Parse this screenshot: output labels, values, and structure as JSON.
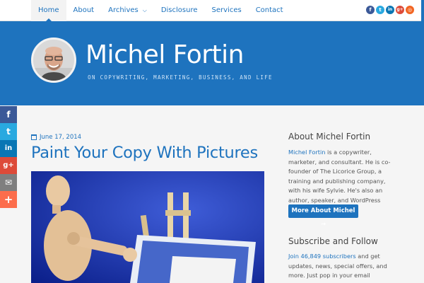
{
  "nav": {
    "items": [
      {
        "label": "Home",
        "active": true
      },
      {
        "label": "About"
      },
      {
        "label": "Archives",
        "has_dropdown": true
      },
      {
        "label": "Disclosure"
      },
      {
        "label": "Services"
      },
      {
        "label": "Contact"
      }
    ],
    "social": [
      {
        "icon": "facebook-icon",
        "glyph": "f",
        "color": "#3b5998"
      },
      {
        "icon": "twitter-icon",
        "glyph": "t",
        "color": "#29a9e0"
      },
      {
        "icon": "linkedin-icon",
        "glyph": "in",
        "color": "#0976b4"
      },
      {
        "icon": "googleplus-icon",
        "glyph": "g+",
        "color": "#dd4b39"
      },
      {
        "icon": "rss-icon",
        "glyph": "◎",
        "color": "#f26522"
      }
    ]
  },
  "header": {
    "site_title": "Michel Fortin",
    "tagline": "ON COPYWRITING, MARKETING, BUSINESS, AND LIFE"
  },
  "share_bar": [
    {
      "icon": "facebook-share-icon",
      "glyph": "f",
      "color": "#3b5998"
    },
    {
      "icon": "twitter-share-icon",
      "glyph": "t",
      "color": "#29a9e0"
    },
    {
      "icon": "linkedin-share-icon",
      "glyph": "in",
      "color": "#0976b4"
    },
    {
      "icon": "googleplus-share-icon",
      "glyph": "g+",
      "color": "#dd4b39"
    },
    {
      "icon": "email-share-icon",
      "glyph": "✉",
      "color": "#7f7f7f"
    },
    {
      "icon": "more-share-icon",
      "glyph": "+",
      "color": "#fc6d4c"
    }
  ],
  "post": {
    "date": "June 17, 2014",
    "title": "Paint Your Copy With Pictures"
  },
  "sidebar": {
    "about": {
      "title": "About Michel Fortin",
      "link": "Michel Fortin",
      "text": " is a copywriter, marketer, and consultant. He is co-founder of The Licorice Group, a training and publishing company, with his wife Sylvie. He's also an author, speaker, and WordPress geek.",
      "button": "More About Michel →"
    },
    "subscribe": {
      "title": "Subscribe and Follow",
      "link": "Join 46,849 subscribers",
      "text": " and get updates, news, special offers, and more. Just pop in your email address and hit the button!"
    }
  }
}
